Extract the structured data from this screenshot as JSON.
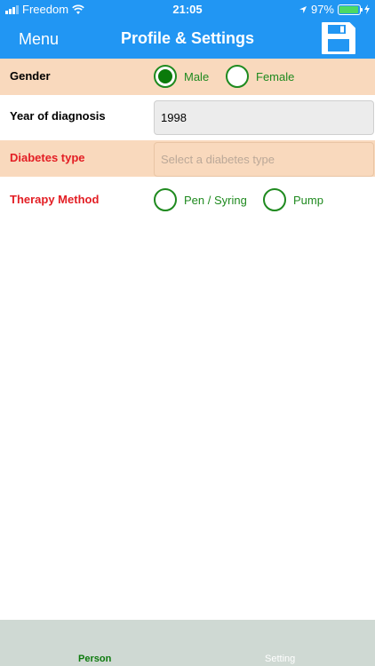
{
  "status_bar": {
    "carrier": "Freedom",
    "time": "21:05",
    "battery_percent": "97%",
    "battery_level": 0.97,
    "icons": [
      "signal-icon",
      "wifi-icon",
      "location-icon",
      "battery-icon",
      "charging-icon"
    ]
  },
  "header": {
    "menu_label": "Menu",
    "title": "Profile & Settings",
    "save_icon": "floppy-disk-icon"
  },
  "form": {
    "gender": {
      "label": "Gender",
      "options": [
        "Male",
        "Female"
      ],
      "selected": "Male"
    },
    "year_of_diagnosis": {
      "label": "Year of diagnosis",
      "value": "1998"
    },
    "diabetes_type": {
      "label": "Diabetes type",
      "placeholder": "Select a diabetes type"
    },
    "therapy_method": {
      "label": "Therapy Method",
      "options": [
        "Pen / Syring",
        "Pump"
      ],
      "selected": ""
    }
  },
  "tabs": [
    {
      "label": "Person",
      "active": true
    },
    {
      "label": "Setting",
      "active": false
    }
  ],
  "colors": {
    "primary": "#2196f3",
    "row_highlight": "#f9d9bd",
    "radio_green": "#1f8a1f",
    "label_red": "#e31e24",
    "tabbar": "#cfd9d3"
  }
}
